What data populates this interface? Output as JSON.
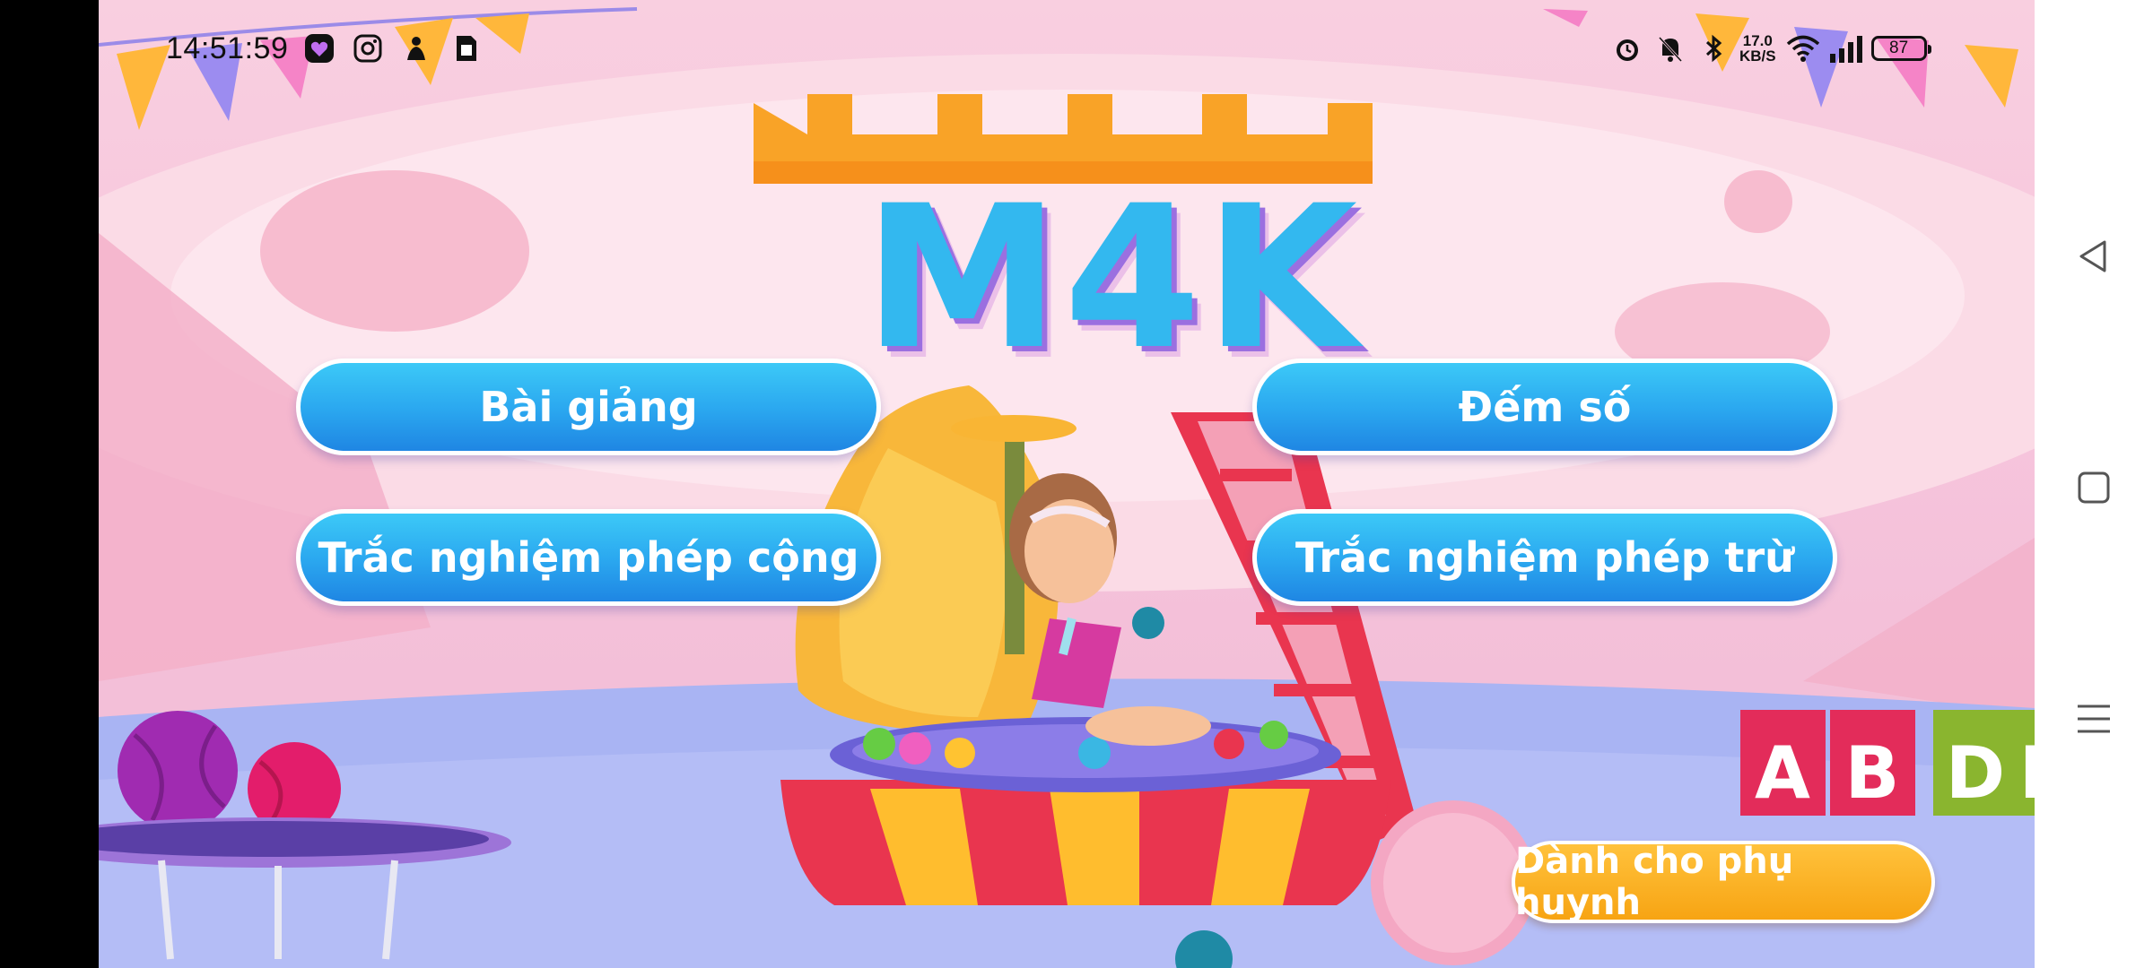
{
  "status_bar": {
    "time": "14:51:59",
    "net_speed_value": "17.0",
    "net_speed_unit": "KB/S",
    "battery_level": "87",
    "left_icons": [
      "chat-app-icon",
      "instagram-icon",
      "notification-app-icon",
      "sim-card-icon"
    ],
    "right_icons": [
      "alarm-icon",
      "silent-bell-icon",
      "bluetooth-icon",
      "wifi-icon",
      "signal-icon",
      "battery-icon"
    ]
  },
  "app": {
    "title": "M4K",
    "menu": {
      "lessons": "Bài giảng",
      "counting": "Đếm số",
      "addition_quiz": "Trắc nghiệm phép cộng",
      "subtraction_quiz": "Trắc nghiệm phép trừ"
    },
    "parents_button": "Dành cho phụ huynh",
    "blocks": [
      "A",
      "B",
      "D",
      "E"
    ],
    "colors": {
      "menu_button": "#2aa6ef",
      "parents_button": "#f7a413",
      "background": "#f6c4dc"
    }
  },
  "nav_bar": {
    "icons": [
      "back-triangle-icon",
      "home-square-icon",
      "menu-lines-icon"
    ]
  }
}
